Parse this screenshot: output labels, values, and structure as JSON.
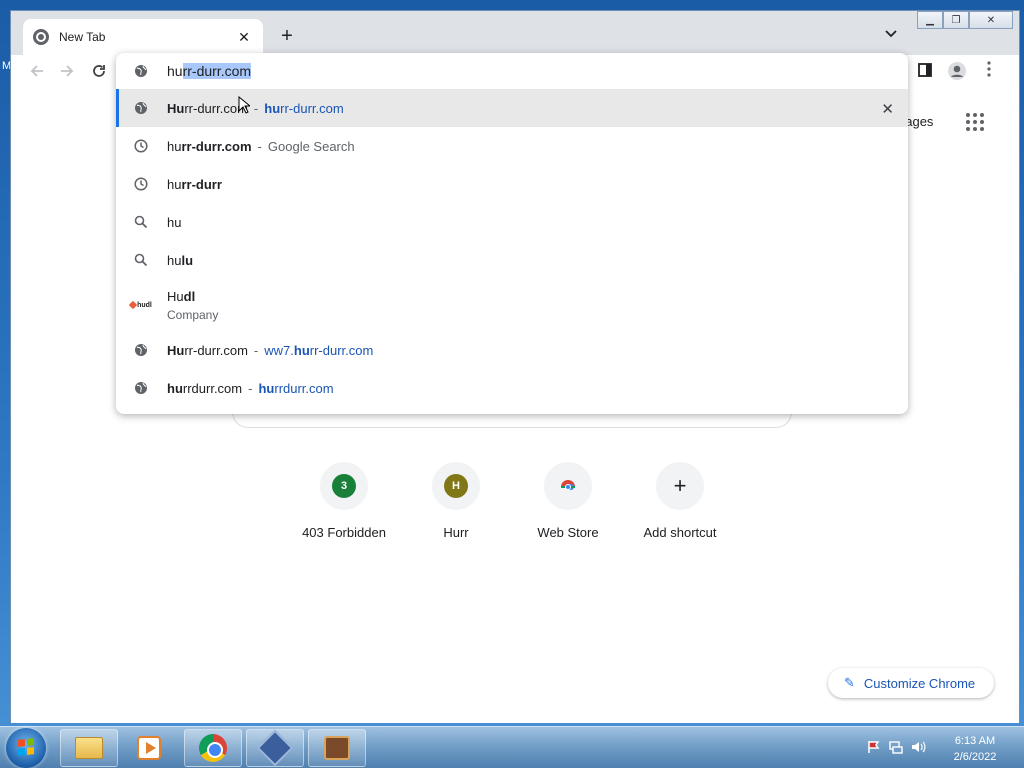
{
  "browser": {
    "tab_title": "New Tab",
    "new_tab_label": "+",
    "tab_close": "✕",
    "tab_search": "⌄"
  },
  "omnibox": {
    "typed": "hu",
    "autocomplete": "rr-durr.com",
    "suggestions": [
      {
        "type": "url",
        "icon": "globe-icon",
        "title_bold": "Hu",
        "title_rest": "rr-durr.com",
        "sep": "-",
        "url_bold": "hu",
        "url_rest": "rr-durr.com",
        "remove": "✕"
      },
      {
        "type": "history-search",
        "icon": "clock-icon",
        "title_pre": "hu",
        "title_bold": "rr-durr.com",
        "sep": "-",
        "suffix": "Google Search"
      },
      {
        "type": "history",
        "icon": "clock-icon",
        "title_pre": "hu",
        "title_bold": "rr-durr"
      },
      {
        "type": "search",
        "icon": "search-icon",
        "title_pre": "hu"
      },
      {
        "type": "search",
        "icon": "search-icon",
        "title_pre": "hu",
        "title_bold": "lu"
      },
      {
        "type": "entity",
        "icon": "hudl-logo",
        "logo_text": "hudl",
        "title_pre": "Hu",
        "title_bold": "dl",
        "subtitle": "Company"
      },
      {
        "type": "url",
        "icon": "globe-icon",
        "title_bold": "Hu",
        "title_rest": "rr-durr.com",
        "sep": "-",
        "url_pre": "ww7.",
        "url_bold": "hu",
        "url_rest": "rr-durr.com"
      },
      {
        "type": "url",
        "icon": "globe-icon",
        "title_bold": "hu",
        "title_rest": "rrdurr.com",
        "sep": "-",
        "url_bold": "hu",
        "url_rest": "rrdurr.com"
      }
    ]
  },
  "ntp": {
    "images_link": "nages",
    "shortcuts": [
      {
        "label": "403 Forbidden",
        "letter": "3",
        "color": "#188038"
      },
      {
        "label": "Hurr",
        "letter": "H",
        "color": "#827717"
      },
      {
        "label": "Web Store",
        "letter": "",
        "color": ""
      },
      {
        "label": "Add shortcut",
        "letter": "+",
        "color": ""
      }
    ],
    "customize_label": "Customize Chrome"
  },
  "taskbar": {
    "time": "6:13 AM",
    "date": "2/6/2022"
  },
  "colors": {
    "accent": "#1a73e8",
    "url_blue": "#1a55b5",
    "selection": "#a8c7fa"
  }
}
